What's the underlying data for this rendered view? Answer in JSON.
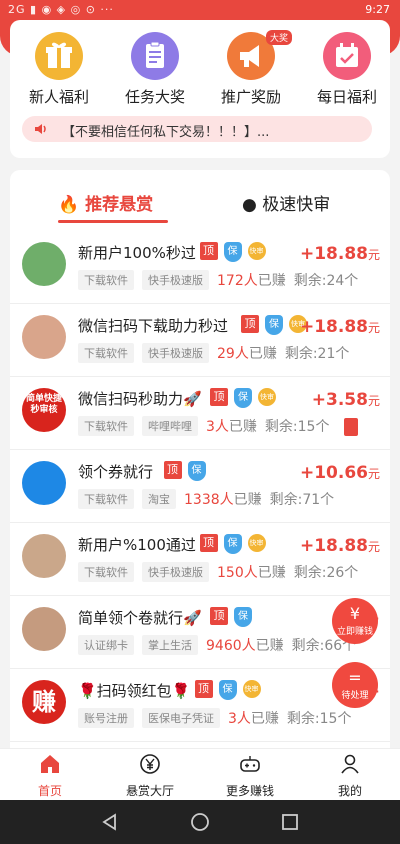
{
  "status": {
    "left": "2G ▮ ◉ ◈ ◎ ⊙ ···",
    "time": "9:27"
  },
  "menu": [
    {
      "label": "新人福利",
      "color": "#f3b534",
      "icon": "gift-icon"
    },
    {
      "label": "任务大奖",
      "color": "#8e7be6",
      "icon": "clipboard-icon"
    },
    {
      "label": "推广奖励",
      "color": "#f07a3a",
      "icon": "megaphone-icon",
      "badge": "大奖"
    },
    {
      "label": "每日福利",
      "color": "#f25d7b",
      "icon": "calendar-icon"
    }
  ],
  "notice": "【不要相信任何私下交易！！！】...",
  "tabs": {
    "active": "推荐悬赏",
    "other": "极速快审"
  },
  "tasks": [
    {
      "title": "新用户100%秒过",
      "ding": "顶",
      "bao": "保",
      "kuai": "快审",
      "amount": "+18.88",
      "unit": "元",
      "chips": [
        "下载软件",
        "快手极速版"
      ],
      "earned": "172人",
      "earned_suffix": "已赚",
      "remain": "剩余:24个",
      "avatar": "#6fae6a"
    },
    {
      "title": "微信扫码下载助力秒过",
      "ding": "顶",
      "bao": "保",
      "kuai": "快审",
      "amount": "+18.88",
      "unit": "元",
      "chips": [
        "下载软件",
        "快手极速版"
      ],
      "earned": "29人",
      "earned_suffix": "已赚",
      "remain": "剩余:21个",
      "avatar": "#d9a58b"
    },
    {
      "title": "微信扫码秒助力🚀",
      "ding": "顶",
      "bao": "保",
      "kuai": "快审",
      "amount": "+3.58",
      "unit": "元",
      "chips": [
        "下载软件",
        "哔哩哔哩"
      ],
      "earned": "3人",
      "earned_suffix": "已赚",
      "remain": "剩余:15个",
      "avatar": "#d8241d"
    },
    {
      "title": "领个券就行",
      "ding": "顶",
      "bao": "保",
      "kuai": "",
      "amount": "+10.66",
      "unit": "元",
      "chips": [
        "下载软件",
        "淘宝"
      ],
      "earned": "1338人",
      "earned_suffix": "已赚",
      "remain": "剩余:71个",
      "avatar": "#1e88e5"
    },
    {
      "title": "新用户%100通过",
      "ding": "顶",
      "bao": "保",
      "kuai": "快审",
      "amount": "+18.88",
      "unit": "元",
      "chips": [
        "下载软件",
        "快手极速版"
      ],
      "earned": "150人",
      "earned_suffix": "已赚",
      "remain": "剩余:26个",
      "avatar": "#caa78a"
    },
    {
      "title": "简单领个卷就行🚀",
      "ding": "顶",
      "bao": "保",
      "kuai": "",
      "amount": "+",
      "unit": "",
      "chips": [
        "认证绑卡",
        "掌上生活"
      ],
      "earned": "9460人",
      "earned_suffix": "已赚",
      "remain": "剩余:66个",
      "avatar": "#c59b7f"
    },
    {
      "title": "🌹扫码领红包🌹",
      "ding": "顶",
      "bao": "保",
      "kuai": "快审",
      "amount": "+",
      "unit": "",
      "chips": [
        "账号注册",
        "医保电子凭证"
      ],
      "earned": "3人",
      "earned_suffix": "已赚",
      "remain": "剩余:15个",
      "avatar": "#d8241d"
    }
  ],
  "avatar_texts": {
    "row3": "简单快捷秒审核",
    "row7": "赚"
  },
  "float": {
    "earn_label": "立即赚钱",
    "earn_icon": "¥",
    "pending_label": "待处理",
    "pending_icon": "="
  },
  "nav": [
    {
      "label": "首页",
      "icon": "home-icon",
      "active": true
    },
    {
      "label": "悬赏大厅",
      "icon": "yen-icon",
      "active": false
    },
    {
      "label": "更多赚钱",
      "icon": "gamepad-icon",
      "active": false
    },
    {
      "label": "我的",
      "icon": "person-icon",
      "active": false
    }
  ],
  "colors": {
    "accent": "#e8473e",
    "bao": "#46a6e8",
    "kuai": "#f3b534"
  }
}
